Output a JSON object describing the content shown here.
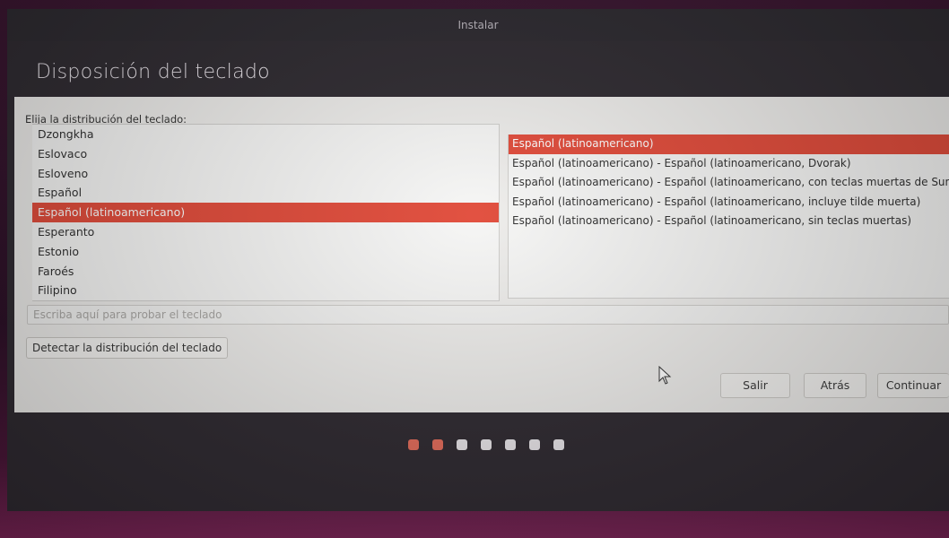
{
  "window": {
    "title": "Instalar"
  },
  "page": {
    "title": "Disposición del teclado"
  },
  "layout_prompt": "Elija la distribución del teclado:",
  "layouts": [
    {
      "label": "Dzongkha",
      "selected": false
    },
    {
      "label": "Eslovaco",
      "selected": false
    },
    {
      "label": "Esloveno",
      "selected": false
    },
    {
      "label": "Español",
      "selected": false
    },
    {
      "label": "Español (latinoamericano)",
      "selected": true
    },
    {
      "label": "Esperanto",
      "selected": false
    },
    {
      "label": "Estonio",
      "selected": false
    },
    {
      "label": "Faroés",
      "selected": false
    },
    {
      "label": "Filipino",
      "selected": false
    }
  ],
  "variants": [
    {
      "label": "Español (latinoamericano)",
      "selected": true
    },
    {
      "label": "Español (latinoamericano) - Español (latinoamericano, Dvorak)",
      "selected": false
    },
    {
      "label": "Español (latinoamericano) - Español (latinoamericano, con teclas muertas de Sun",
      "selected": false
    },
    {
      "label": "Español (latinoamericano) - Español (latinoamericano, incluye tilde muerta)",
      "selected": false
    },
    {
      "label": "Español (latinoamericano) - Español (latinoamericano, sin teclas muertas)",
      "selected": false
    }
  ],
  "test_input": {
    "value": "",
    "placeholder": "Escriba aquí para probar el teclado"
  },
  "buttons": {
    "detect": "Detectar la distribución del teclado",
    "quit": "Salir",
    "back": "Atrás",
    "continue": "Continuar"
  },
  "progress": {
    "total_steps": 7,
    "completed_steps": 2
  },
  "colors": {
    "selection": "#e14b3a",
    "progress_done": "#e46c5a",
    "progress_pending": "#e9e6ea"
  }
}
